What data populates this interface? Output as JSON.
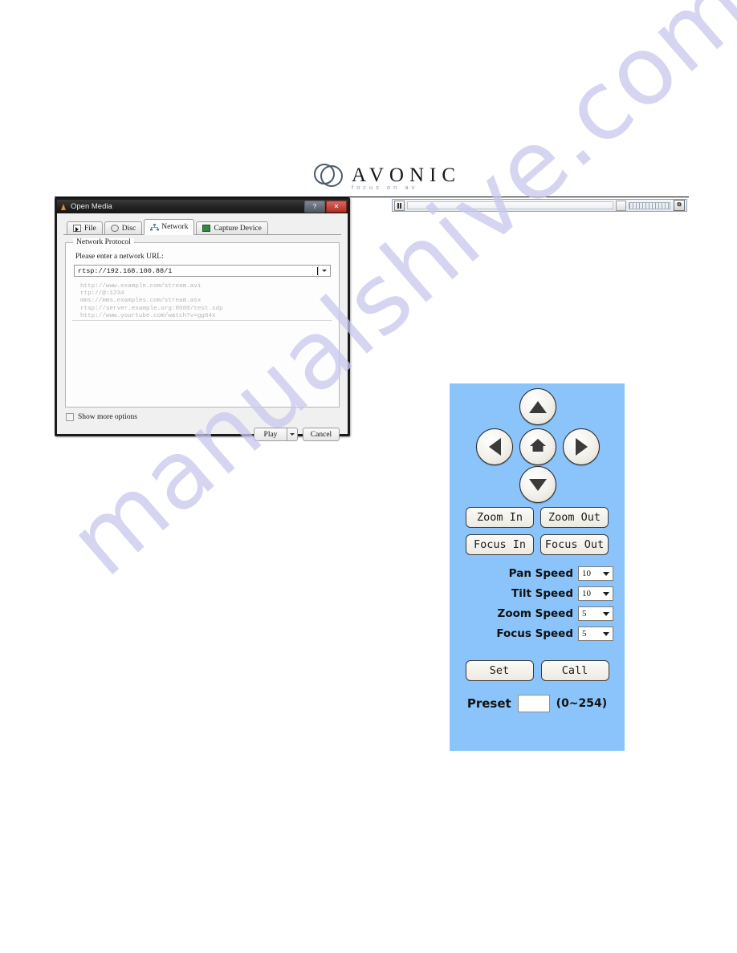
{
  "brand": {
    "name": "AVONIC",
    "tagline": "focus on av",
    "logo_icon": "interlocking-rings-icon"
  },
  "watermark": {
    "text": "manualshive.com",
    "color": "#c8c8ee"
  },
  "dialog": {
    "title": "Open Media",
    "app_icon": "vlc-cone-icon",
    "titlebar_buttons": [
      {
        "name": "help-button",
        "label": "?"
      },
      {
        "name": "close-button",
        "label": "✕"
      }
    ],
    "tabs": [
      {
        "label": "File",
        "icon": "file-icon",
        "active": false
      },
      {
        "label": "Disc",
        "icon": "disc-icon",
        "active": false
      },
      {
        "label": "Network",
        "icon": "network-icon",
        "active": true
      },
      {
        "label": "Capture Device",
        "icon": "capture-device-icon",
        "active": false
      }
    ],
    "group_title": "Network Protocol",
    "url_label": "Please enter a network URL:",
    "url_value": "rtsp://192.168.100.88/1",
    "url_placeholder": "Please enter a network URL",
    "examples": [
      "http://www.example.com/stream.avi",
      "rtp://@:1234",
      "mms://mms.examples.com/stream.asx",
      "rtsp://server.example.org:8080/test.sdp",
      "http://www.yourtube.com/watch?v=gg64x"
    ],
    "show_more_options": "Show more options",
    "show_more_options_checked": false,
    "play_label": "Play",
    "play_dropdown_icon": "chevron-down-icon",
    "cancel_label": "Cancel"
  },
  "player_bar": {
    "pause_icon": "pause-icon",
    "seek_slider": "seek-slider",
    "mute_icon": "mute-icon",
    "volume_slider": "volume-slider",
    "fullscreen_label": "⧉"
  },
  "ptz": {
    "background_color": "#8ac4fb",
    "dpad": [
      {
        "name": "pan-up-button",
        "icon": "triangle-up-icon"
      },
      {
        "name": "pan-left-button",
        "icon": "triangle-left-icon"
      },
      {
        "name": "home-button",
        "icon": "home-icon"
      },
      {
        "name": "pan-right-button",
        "icon": "triangle-right-icon"
      },
      {
        "name": "pan-down-button",
        "icon": "triangle-down-icon"
      }
    ],
    "zoom_in": "Zoom In",
    "zoom_out": "Zoom Out",
    "focus_in": "Focus In",
    "focus_out": "Focus Out",
    "speeds": [
      {
        "label": "Pan Speed",
        "value": "10"
      },
      {
        "label": "Tilt Speed",
        "value": "10"
      },
      {
        "label": "Zoom Speed",
        "value": "5"
      },
      {
        "label": "Focus Speed",
        "value": "5"
      }
    ],
    "set_label": "Set",
    "call_label": "Call",
    "preset_label": "Preset",
    "preset_value": "",
    "preset_range": "(0~254)"
  }
}
